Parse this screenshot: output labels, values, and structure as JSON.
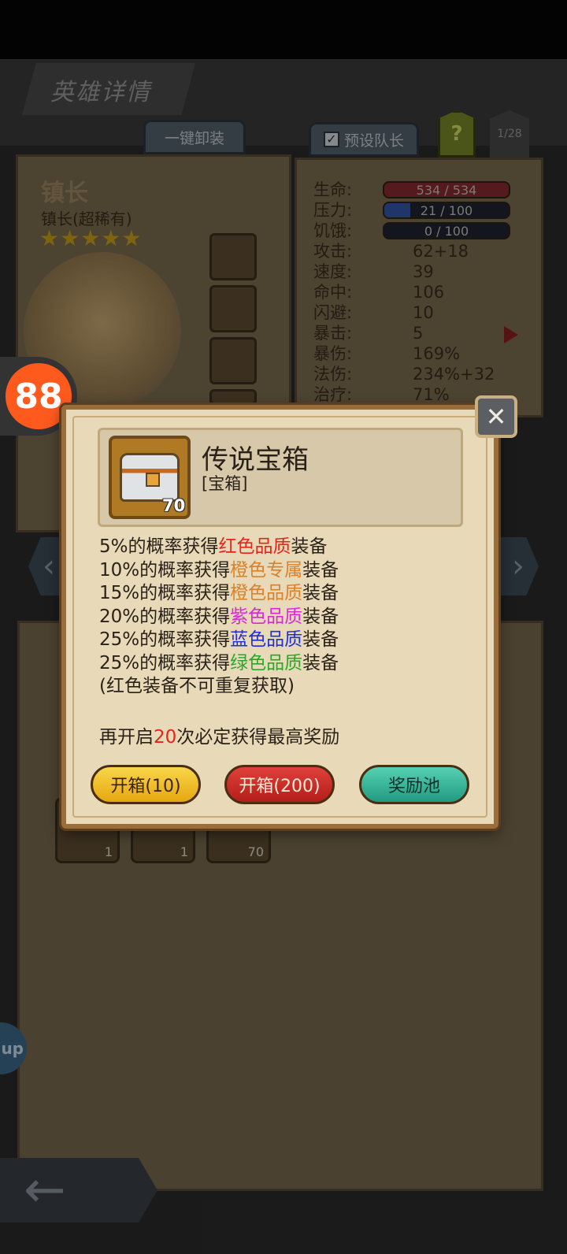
{
  "screen": {
    "title": "英雄详情",
    "unequip_all_label": "一键卸装",
    "preset_captain_label": "预设队长",
    "preset_checkbox": "✓",
    "help_label": "?",
    "page_indicator": "1/28"
  },
  "hero": {
    "name": "镇长",
    "class_label": "镇长(超稀有)",
    "stars": "★★★★★",
    "star_count": 5
  },
  "stats": {
    "hp": {
      "label": "生命:",
      "value": "534 / 534"
    },
    "stress": {
      "label": "压力:",
      "value": "21 / 100",
      "fraction": 0.21
    },
    "hunger": {
      "label": "饥饿:",
      "value": "0 / 100"
    },
    "rows": [
      {
        "label": "攻击:",
        "value": "62+18"
      },
      {
        "label": "速度:",
        "value": "39"
      },
      {
        "label": "命中:",
        "value": "106"
      },
      {
        "label": "闪避:",
        "value": "10"
      },
      {
        "label": "暴击:",
        "value": "5"
      },
      {
        "label": "暴伤:",
        "value": "169%"
      },
      {
        "label": "法伤:",
        "value": "234%+32"
      },
      {
        "label": "治疗:",
        "value": "71%"
      }
    ]
  },
  "inventory": {
    "counts": [
      "1",
      "1",
      "70"
    ]
  },
  "dialog": {
    "item_name": "传说宝箱",
    "item_type": "[宝箱]",
    "item_count": "70",
    "lines": [
      {
        "prefix": "5%的概率获得",
        "highlight": "红色品质",
        "suffix": "装备",
        "color": "#e8231b"
      },
      {
        "prefix": "10%的概率获得",
        "highlight": "橙色专属",
        "suffix": "装备",
        "color": "#d9822b"
      },
      {
        "prefix": "15%的概率获得",
        "highlight": "橙色品质",
        "suffix": "装备",
        "color": "#d9822b"
      },
      {
        "prefix": "20%的概率获得",
        "highlight": "紫色品质",
        "suffix": "装备",
        "color": "#d62ad6"
      },
      {
        "prefix": "25%的概率获得",
        "highlight": "蓝色品质",
        "suffix": "装备",
        "color": "#1f2fd6"
      },
      {
        "prefix": "25%的概率获得",
        "highlight": "绿色品质",
        "suffix": "装备",
        "color": "#2aa82a"
      }
    ],
    "note": "(红色装备不可重复获取)",
    "footer_prefix": "再开启",
    "footer_number": "20",
    "footer_suffix": "次必定获得最高奖励",
    "footer_number_color": "#e8231b",
    "buttons": {
      "open10": "开箱(10)",
      "open200": "开箱(200)",
      "pool": "奖励池"
    }
  },
  "overlay": {
    "app_badge_text": "up"
  }
}
